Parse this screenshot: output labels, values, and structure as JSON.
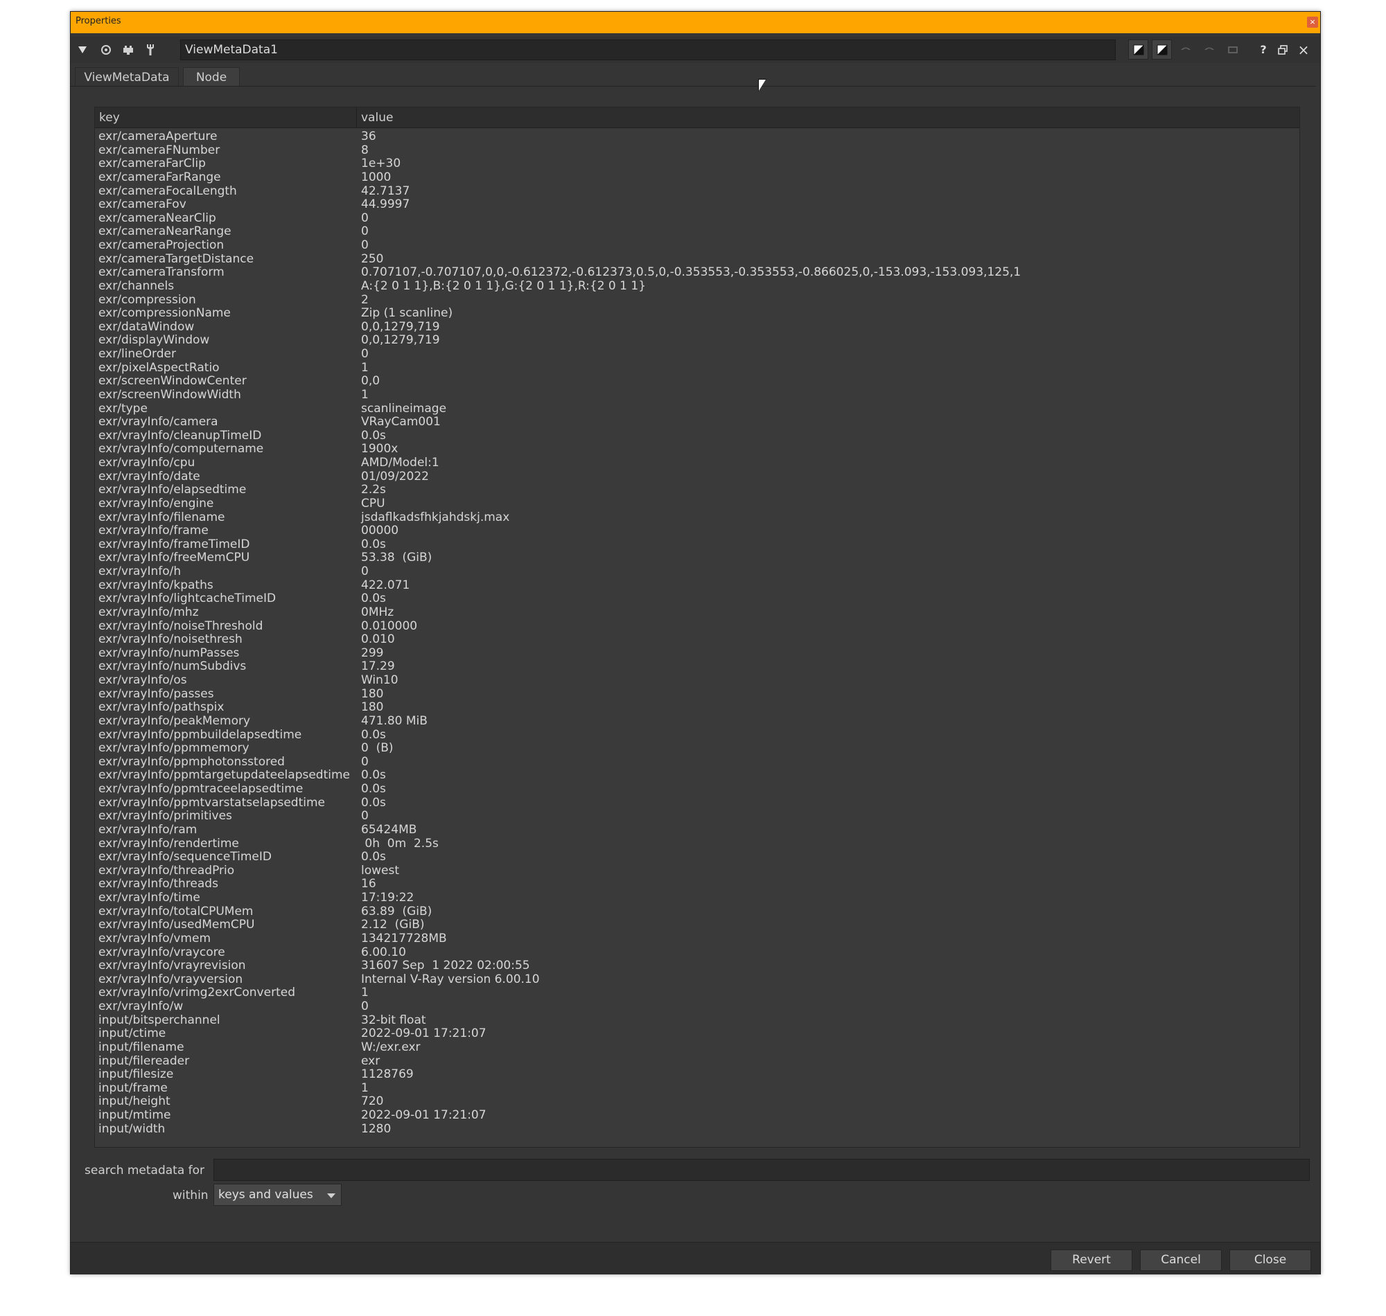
{
  "window": {
    "title": "Properties",
    "close_glyph": "×"
  },
  "toolbar": {
    "node_name": "ViewMetaData1",
    "icons": [
      "collapse-arrow-icon",
      "visibility-icon",
      "settings-icon",
      "wrench-icon",
      "color-swatch-icon",
      "color-swatch-icon",
      "undo-icon",
      "redo-icon",
      "revert-icon",
      "help-icon",
      "float-window-icon",
      "close-panel-icon"
    ],
    "help_glyph": "?",
    "close_glyph": "×"
  },
  "tabs": [
    {
      "label": "ViewMetaData",
      "active": true
    },
    {
      "label": "Node",
      "active": false
    }
  ],
  "table": {
    "headers": {
      "key": "key",
      "value": "value"
    },
    "rows": [
      [
        "exr/cameraAperture",
        "36"
      ],
      [
        "exr/cameraFNumber",
        "8"
      ],
      [
        "exr/cameraFarClip",
        "1e+30"
      ],
      [
        "exr/cameraFarRange",
        "1000"
      ],
      [
        "exr/cameraFocalLength",
        "42.7137"
      ],
      [
        "exr/cameraFov",
        "44.9997"
      ],
      [
        "exr/cameraNearClip",
        "0"
      ],
      [
        "exr/cameraNearRange",
        "0"
      ],
      [
        "exr/cameraProjection",
        "0"
      ],
      [
        "exr/cameraTargetDistance",
        "250"
      ],
      [
        "exr/cameraTransform",
        "0.707107,-0.707107,0,0,-0.612372,-0.612373,0.5,0,-0.353553,-0.353553,-0.866025,0,-153.093,-153.093,125,1"
      ],
      [
        "exr/channels",
        "A:{2 0 1 1},B:{2 0 1 1},G:{2 0 1 1},R:{2 0 1 1}"
      ],
      [
        "exr/compression",
        "2"
      ],
      [
        "exr/compressionName",
        "Zip (1 scanline)"
      ],
      [
        "exr/dataWindow",
        "0,0,1279,719"
      ],
      [
        "exr/displayWindow",
        "0,0,1279,719"
      ],
      [
        "exr/lineOrder",
        "0"
      ],
      [
        "exr/pixelAspectRatio",
        "1"
      ],
      [
        "exr/screenWindowCenter",
        "0,0"
      ],
      [
        "exr/screenWindowWidth",
        "1"
      ],
      [
        "exr/type",
        "scanlineimage"
      ],
      [
        "exr/vrayInfo/camera",
        "VRayCam001"
      ],
      [
        "exr/vrayInfo/cleanupTimeID",
        "0.0s"
      ],
      [
        "exr/vrayInfo/computername",
        "1900x"
      ],
      [
        "exr/vrayInfo/cpu",
        "AMD/Model:1"
      ],
      [
        "exr/vrayInfo/date",
        "01/09/2022"
      ],
      [
        "exr/vrayInfo/elapsedtime",
        "2.2s"
      ],
      [
        "exr/vrayInfo/engine",
        "CPU"
      ],
      [
        "exr/vrayInfo/filename",
        "jsdaflkadsfhkjahdskj.max"
      ],
      [
        "exr/vrayInfo/frame",
        "00000"
      ],
      [
        "exr/vrayInfo/frameTimeID",
        "0.0s"
      ],
      [
        "exr/vrayInfo/freeMemCPU",
        "53.38  (GiB)"
      ],
      [
        "exr/vrayInfo/h",
        "0"
      ],
      [
        "exr/vrayInfo/kpaths",
        "422.071"
      ],
      [
        "exr/vrayInfo/lightcacheTimeID",
        "0.0s"
      ],
      [
        "exr/vrayInfo/mhz",
        "0MHz"
      ],
      [
        "exr/vrayInfo/noiseThreshold",
        "0.010000"
      ],
      [
        "exr/vrayInfo/noisethresh",
        "0.010"
      ],
      [
        "exr/vrayInfo/numPasses",
        "299"
      ],
      [
        "exr/vrayInfo/numSubdivs",
        "17.29"
      ],
      [
        "exr/vrayInfo/os",
        "Win10"
      ],
      [
        "exr/vrayInfo/passes",
        "180"
      ],
      [
        "exr/vrayInfo/pathspix",
        "180"
      ],
      [
        "exr/vrayInfo/peakMemory",
        "471.80 MiB"
      ],
      [
        "exr/vrayInfo/ppmbuildelapsedtime",
        "0.0s"
      ],
      [
        "exr/vrayInfo/ppmmemory",
        "0  (B)"
      ],
      [
        "exr/vrayInfo/ppmphotonsstored",
        "0"
      ],
      [
        "exr/vrayInfo/ppmtargetupdateelapsedtime",
        "0.0s"
      ],
      [
        "exr/vrayInfo/ppmtraceelapsedtime",
        "0.0s"
      ],
      [
        "exr/vrayInfo/ppmtvarstatselapsedtime",
        "0.0s"
      ],
      [
        "exr/vrayInfo/primitives",
        "0"
      ],
      [
        "exr/vrayInfo/ram",
        "65424MB"
      ],
      [
        "exr/vrayInfo/rendertime",
        " 0h  0m  2.5s"
      ],
      [
        "exr/vrayInfo/sequenceTimeID",
        "0.0s"
      ],
      [
        "exr/vrayInfo/threadPrio",
        "lowest"
      ],
      [
        "exr/vrayInfo/threads",
        "16"
      ],
      [
        "exr/vrayInfo/time",
        "17:19:22"
      ],
      [
        "exr/vrayInfo/totalCPUMem",
        "63.89  (GiB)"
      ],
      [
        "exr/vrayInfo/usedMemCPU",
        "2.12  (GiB)"
      ],
      [
        "exr/vrayInfo/vmem",
        "134217728MB"
      ],
      [
        "exr/vrayInfo/vraycore",
        "6.00.10"
      ],
      [
        "exr/vrayInfo/vrayrevision",
        "31607 Sep  1 2022 02:00:55"
      ],
      [
        "exr/vrayInfo/vrayversion",
        "Internal V-Ray version 6.00.10"
      ],
      [
        "exr/vrayInfo/vrimg2exrConverted",
        "1"
      ],
      [
        "exr/vrayInfo/w",
        "0"
      ],
      [
        "input/bitsperchannel",
        "32-bit float"
      ],
      [
        "input/ctime",
        "2022-09-01 17:21:07"
      ],
      [
        "input/filename",
        "W:/exr.exr"
      ],
      [
        "input/filereader",
        "exr"
      ],
      [
        "input/filesize",
        "1128769"
      ],
      [
        "input/frame",
        "1"
      ],
      [
        "input/height",
        "720"
      ],
      [
        "input/mtime",
        "2022-09-01 17:21:07"
      ],
      [
        "input/width",
        "1280"
      ]
    ]
  },
  "search": {
    "label": "search metadata for",
    "value": "",
    "within_label": "within",
    "within_selected": "keys and values"
  },
  "buttons": {
    "revert": "Revert",
    "cancel": "Cancel",
    "close": "Close"
  },
  "colors": {
    "titlebar": "#ffa500",
    "panel": "#353535",
    "text": "#d6d6d6"
  }
}
